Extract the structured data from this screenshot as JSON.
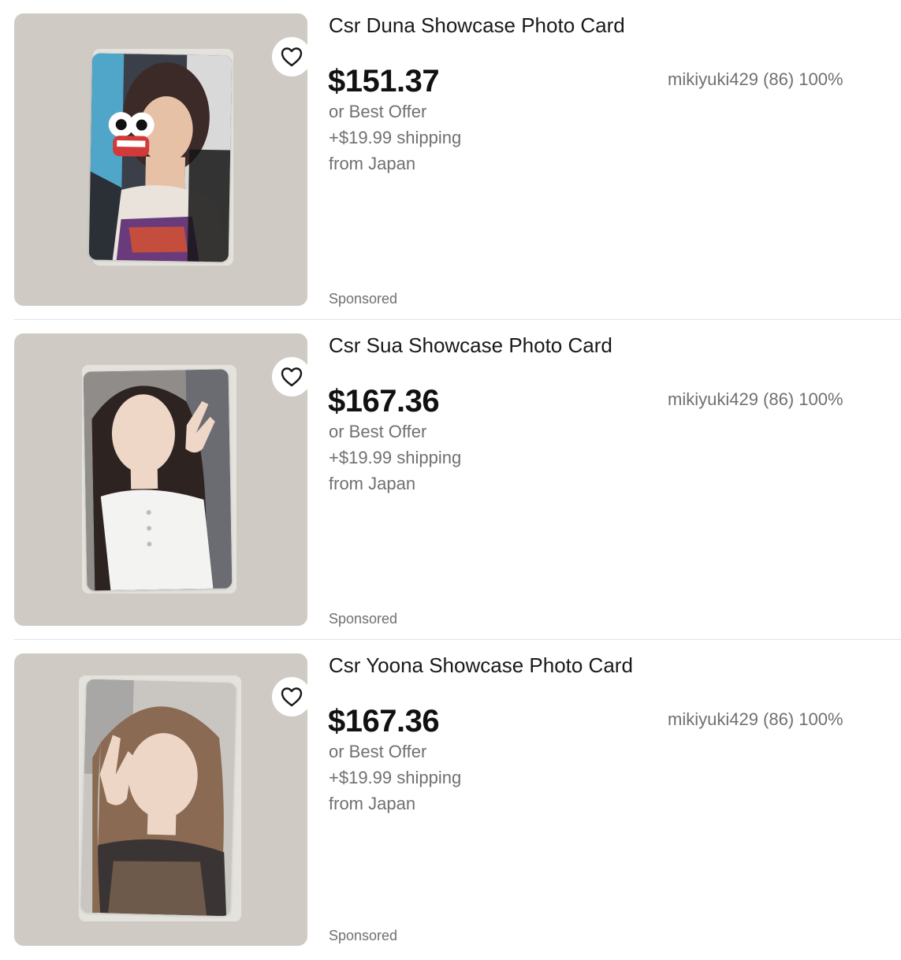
{
  "listings": [
    {
      "title": "Csr Duna Showcase Photo Card",
      "price": "$151.37",
      "offer": "or Best Offer",
      "shipping": "+$19.99 shipping",
      "origin": "from Japan",
      "seller": "mikiyuki429 (86) 100%",
      "sponsored": "Sponsored"
    },
    {
      "title": "Csr Sua Showcase Photo Card",
      "price": "$167.36",
      "offer": "or Best Offer",
      "shipping": "+$19.99 shipping",
      "origin": "from Japan",
      "seller": "mikiyuki429 (86) 100%",
      "sponsored": "Sponsored"
    },
    {
      "title": "Csr Yoona Showcase Photo Card",
      "price": "$167.36",
      "offer": "or Best Offer",
      "shipping": "+$19.99 shipping",
      "origin": "from Japan",
      "seller": "mikiyuki429 (86) 100%",
      "sponsored": "Sponsored"
    }
  ],
  "icons": {
    "watch": "heart-icon"
  },
  "colors": {
    "text_primary": "#191919",
    "text_secondary": "#707070",
    "divider": "#e1e1e1",
    "thumb_bg": "#cfcbc4"
  }
}
